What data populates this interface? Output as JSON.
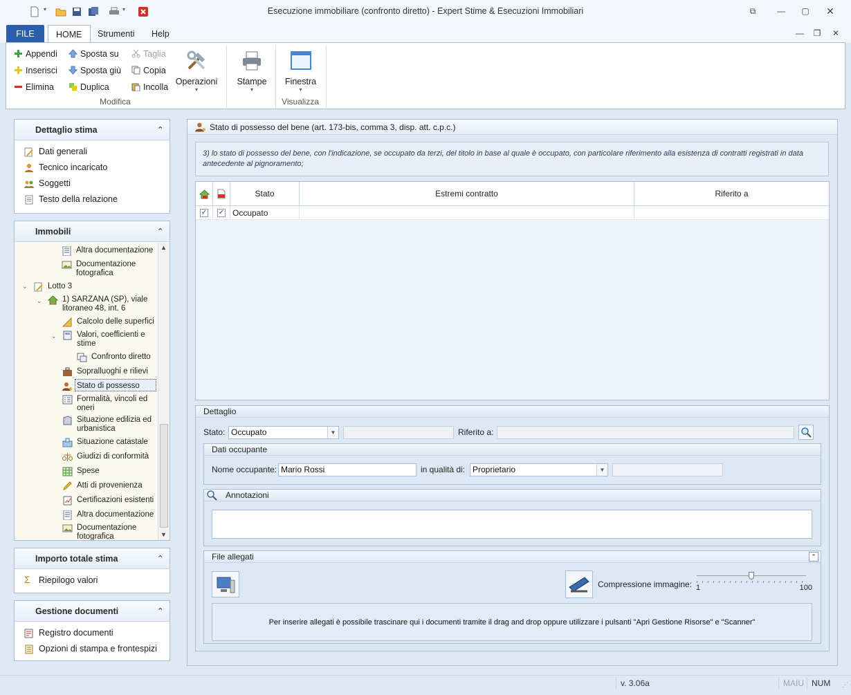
{
  "window": {
    "title": "Esecuzione immobiliare (confronto diretto) - Expert Stime & Esecuzioni Immobiliari",
    "controls": [
      "restore-small",
      "minimize",
      "maximize",
      "close"
    ]
  },
  "ribbon": {
    "tabs": [
      "FILE",
      "HOME",
      "Strumenti",
      "Help"
    ],
    "modifica": {
      "append": "Appendi",
      "insert": "Inserisci",
      "delete": "Elimina",
      "move_up": "Sposta su",
      "move_down": "Sposta giù",
      "duplicate": "Duplica",
      "cut": "Taglia",
      "copy": "Copia",
      "paste": "Incolla",
      "operations": "Operazioni",
      "group_label": "Modifica"
    },
    "print": "Stampe",
    "window_btn": "Finestra",
    "visualizza_label": "Visualizza"
  },
  "left": {
    "dettaglio": {
      "title": "Dettaglio stima",
      "items": [
        "Dati generali",
        "Tecnico incaricato",
        "Soggetti",
        "Testo della relazione"
      ]
    },
    "immobili": {
      "title": "Immobili",
      "tree": {
        "n1": "Altra documentazione",
        "n2": "Documentazione fotografica",
        "lotto": "Lotto 3",
        "bene": "1) SARZANA (SP), viale litoraneo 48, int. 6",
        "calcolo": "Calcolo delle superfici",
        "valori": "Valori, coefficienti e stime",
        "confronto": "Confronto diretto",
        "sopralluoghi": "Sopralluoghi e rilievi",
        "stato": "Stato di possesso",
        "formalita": "Formalità, vincoli ed oneri",
        "situazione_ed": "Situazione edilizia ed urbanistica",
        "catastale": "Situazione catastale",
        "giudizi": "Giudizi di conformità",
        "spese": "Spese",
        "atti": "Atti di provenienza",
        "certificazioni": "Certificazioni esistenti",
        "altra": "Altra documentazione",
        "doc_foto": "Documentazione fotografica"
      }
    },
    "importo": {
      "title": "Importo totale stima",
      "items": [
        "Riepilogo valori"
      ]
    },
    "gestione": {
      "title": "Gestione documenti",
      "items": [
        "Registro documenti",
        "Opzioni di stampa e frontespizi"
      ]
    }
  },
  "main": {
    "title": "Stato di possesso del bene (art. 173-bis, comma 3, disp. att. c.p.c.)",
    "info": "3) lo stato di possesso del bene, con l'indicazione, se occupato da terzi, del titolo in base al quale è occupato, con particolare riferimento alla esistenza di contratti registrati in data antecedente al pignoramento;",
    "grid": {
      "columns": [
        "Stato",
        "Estremi contratto",
        "Riferito a"
      ],
      "rows": [
        {
          "check1": true,
          "check2": true,
          "stato": "Occupato",
          "estremi": "",
          "riferito": ""
        }
      ]
    },
    "dettaglio": {
      "legend": "Dettaglio",
      "stato_label": "Stato:",
      "stato_value": "Occupato",
      "riferito_label": "Riferito a:",
      "occupante": {
        "legend": "Dati occupante",
        "nome_label": "Nome occupante:",
        "nome_value": "Mario Rossi",
        "qualita_label": "in qualità di:",
        "qualita_value": "Proprietario"
      },
      "annotazioni": {
        "legend": "Annotazioni"
      },
      "allegati": {
        "legend": "File allegati",
        "compressione_label": "Compressione immagine:",
        "slider_min": "1",
        "slider_max": "100",
        "slider_value_fraction": 0.5,
        "drop_hint": "Per inserire allegati è possibile trascinare qui i documenti tramite il drag and drop oppure utilizzare i pulsanti \"Apri Gestione Risorse\" e \"Scanner\""
      }
    }
  },
  "status": {
    "version": "v. 3.06a",
    "maiu": "MAIU",
    "num": "NUM"
  },
  "colors": {
    "accent": "#2b5fae",
    "panel_border": "#a9bdd6",
    "tree_bg": "#fbfaf0"
  }
}
